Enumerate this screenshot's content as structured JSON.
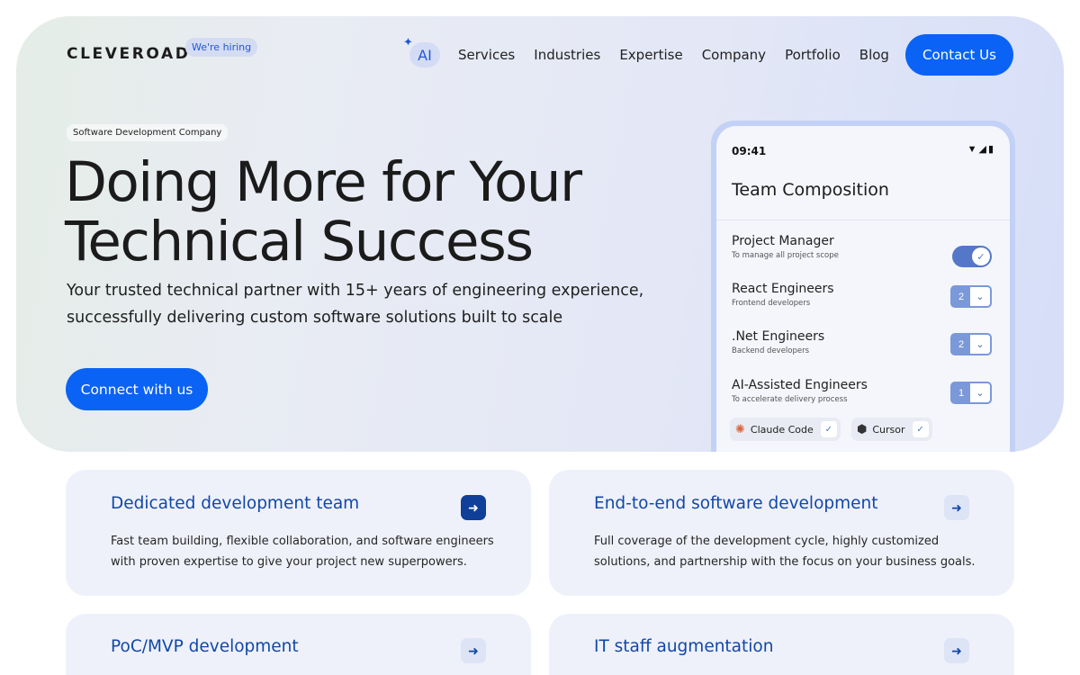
{
  "header": {
    "logo": "CLEVEROAD",
    "hiring_badge": "We're hiring",
    "nav": {
      "ai_label": "AI",
      "ai_spark_icon": "sparkle-icon",
      "items": [
        "Services",
        "Industries",
        "Expertise",
        "Company",
        "Portfolio",
        "Blog"
      ]
    },
    "contact_label": "Contact Us"
  },
  "hero": {
    "tag": "Software Development Company",
    "headline_line1": "Doing More for Your",
    "headline_line2": "Technical Success",
    "subhead_line1": "Your trusted technical partner with 15+ years of engineering experience,",
    "subhead_line2": "successfully delivering custom software solutions built to scale",
    "cta_label": "Connect with us"
  },
  "phone": {
    "time": "09:41",
    "status_icons": [
      "wifi-icon",
      "signal-icon",
      "battery-icon"
    ],
    "title": "Team Composition",
    "roles": [
      {
        "name": "Project Manager",
        "desc": "To manage all project scope",
        "control": "toggle",
        "enabled": true
      },
      {
        "name": "React Engineers",
        "desc": "Frontend developers",
        "control": "stepper",
        "count": "2"
      },
      {
        "name": ".Net Engineers",
        "desc": "Backend developers",
        "control": "stepper",
        "count": "2"
      },
      {
        "name": "AI-Assisted Engineers",
        "desc": "To accelerate delivery process",
        "control": "stepper",
        "count": "1"
      }
    ],
    "tools": [
      {
        "name": "Claude Code",
        "icon": "claude-icon",
        "checked": true
      },
      {
        "name": "Cursor",
        "icon": "cursor-icon",
        "checked": true
      }
    ]
  },
  "cards": [
    {
      "title": "Dedicated development team",
      "line1": "Fast team building, flexible collaboration, and software engineers",
      "line2": "with proven expertise to give your project new superpowers.",
      "active": true
    },
    {
      "title": "End-to-end software development",
      "line1": "Full coverage of the development cycle, highly customized",
      "line2": "solutions, and partnership with the focus on your business goals.",
      "active": false
    },
    {
      "title": "PoC/MVP development",
      "line1": "",
      "line2": "",
      "active": false
    },
    {
      "title": "IT staff augmentation",
      "line1": "",
      "line2": "",
      "active": false
    }
  ],
  "colors": {
    "accent": "#0a63f5",
    "card_title": "#1048a8",
    "card_bg": "#eff1fa"
  }
}
